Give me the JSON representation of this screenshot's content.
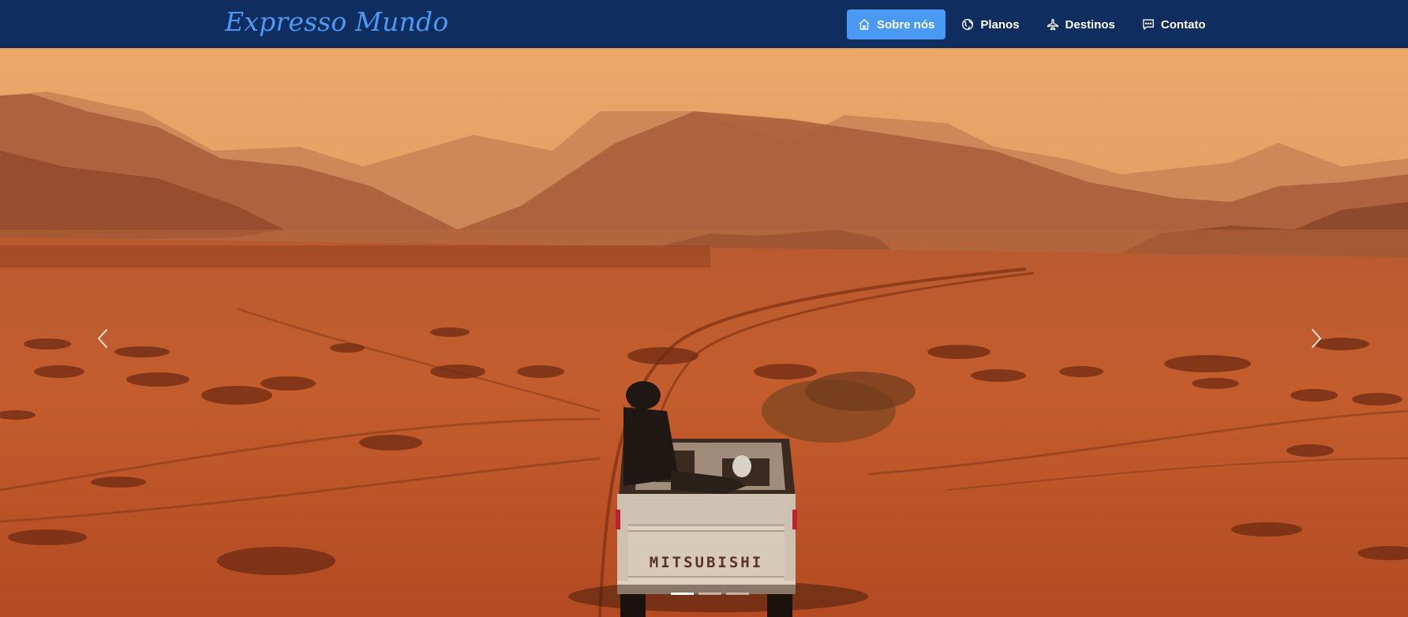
{
  "navbar": {
    "brand": "Expresso Mundo",
    "items": [
      {
        "label": "Sobre nós",
        "icon": "home-icon",
        "active": true
      },
      {
        "label": "Planos",
        "icon": "globe-icon",
        "active": false
      },
      {
        "label": "Destinos",
        "icon": "airplane-icon",
        "active": false
      },
      {
        "label": "Contato",
        "icon": "chat-icon",
        "active": false
      }
    ]
  },
  "carousel": {
    "vehicle_text": "MITSUBISHI",
    "prev_icon": "chevron-left-icon",
    "next_icon": "chevron-right-icon",
    "slide_count": 3,
    "active_slide": 1
  },
  "colors": {
    "navbar": "#0f2d5e",
    "brand": "#4a9af5",
    "active_nav": "#4a9af5"
  }
}
